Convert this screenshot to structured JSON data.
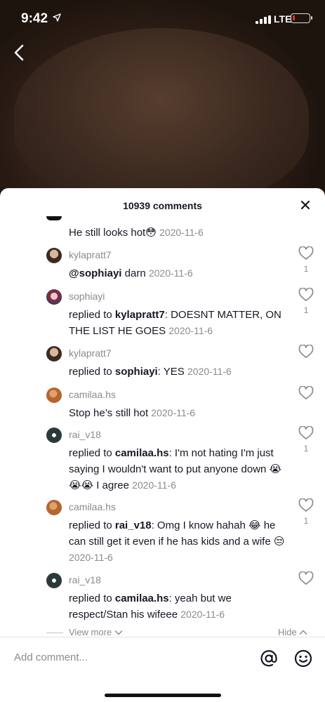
{
  "status_bar": {
    "time": "9:42",
    "network": "LTE"
  },
  "sheet": {
    "title": "10939 comments"
  },
  "comments": [
    {
      "username": "",
      "parts": [
        {
          "t": "He still looks hot😳"
        }
      ],
      "date": "2020-11-6",
      "likes": ""
    },
    {
      "username": "kylapratt7",
      "parts": [
        {
          "t": "@sophiayi",
          "b": true
        },
        {
          "t": " darn"
        }
      ],
      "date": "2020-11-6",
      "likes": "1"
    },
    {
      "username": "sophiayi",
      "parts": [
        {
          "t": "replied to "
        },
        {
          "t": "kylapratt7",
          "b": true
        },
        {
          "t": ": DOESNT MATTER, ON THE LIST HE GOES"
        }
      ],
      "date": "2020-11-6",
      "likes": "1"
    },
    {
      "username": "kylapratt7",
      "parts": [
        {
          "t": "replied to "
        },
        {
          "t": "sophiayi",
          "b": true
        },
        {
          "t": ": YES"
        }
      ],
      "date": "2020-11-6",
      "likes": ""
    },
    {
      "username": "camilaa.hs",
      "parts": [
        {
          "t": "Stop he’s still hot"
        }
      ],
      "date": "2020-11-6",
      "likes": ""
    },
    {
      "username": "rai_v18",
      "parts": [
        {
          "t": "replied to "
        },
        {
          "t": "camilaa.hs",
          "b": true
        },
        {
          "t": ": I'm not hating I'm just saying I wouldn't want to put anyone down 😭😭😭 I agree"
        }
      ],
      "date": "2020-11-6",
      "likes": "1"
    },
    {
      "username": "camilaa.hs",
      "parts": [
        {
          "t": "replied to "
        },
        {
          "t": "rai_v18",
          "b": true
        },
        {
          "t": ": Omg I know hahah 😂 he can still get it even if he has kids and a wife 😒"
        }
      ],
      "date": "2020-11-6",
      "likes": "1"
    },
    {
      "username": "rai_v18",
      "parts": [
        {
          "t": "replied to "
        },
        {
          "t": "camilaa.hs",
          "b": true
        },
        {
          "t": ": yeah but we respect/Stan his wifeee"
        }
      ],
      "date": "2020-11-6",
      "likes": ""
    }
  ],
  "footer": {
    "view_more": "View more",
    "hide": "Hide",
    "add_comment_placeholder": "Add comment..."
  },
  "colors": {
    "text": "#161823",
    "muted": "#8a8b91",
    "battery_low": "#e0322b"
  },
  "icons": {
    "back": "chevron-left-icon",
    "close": "close-icon",
    "like": "heart-outline-icon",
    "at": "at-sign-icon",
    "emoji": "smiley-icon"
  }
}
